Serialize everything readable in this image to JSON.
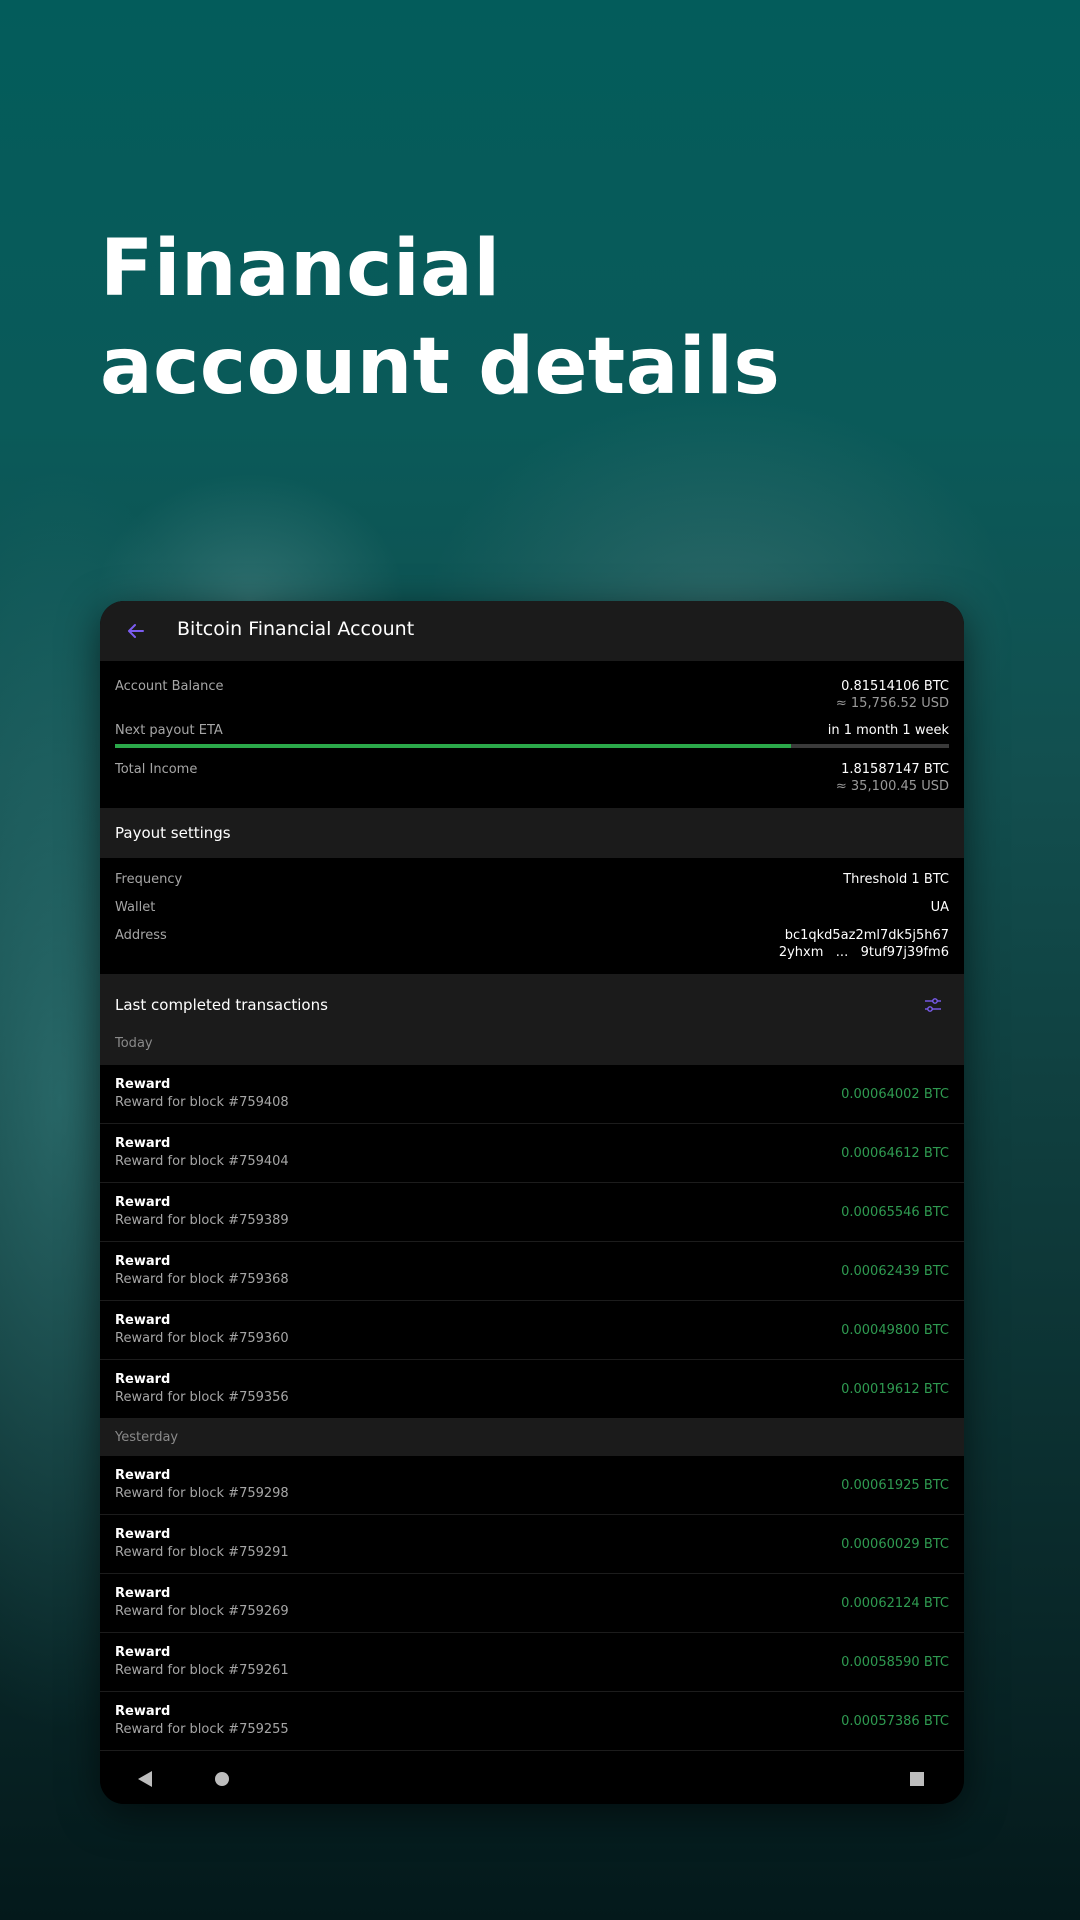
{
  "hero": {
    "title": "Financial account details"
  },
  "app": {
    "title": "Bitcoin Financial Account",
    "accent_color": "#7b5cf0"
  },
  "account": {
    "balance_label": "Account Balance",
    "balance_btc": "0.81514106 BTC",
    "balance_usd": "≈ 15,756.52 USD",
    "payout_label": "Next payout ETA",
    "payout_value": "in 1 month 1 week",
    "payout_progress": 0.81,
    "income_label": "Total Income",
    "income_btc": "1.81587147 BTC",
    "income_usd": "≈ 35,100.45 USD"
  },
  "payout_settings": {
    "title": "Payout settings",
    "frequency_label": "Frequency",
    "frequency_value": "Threshold 1 BTC",
    "wallet_label": "Wallet",
    "wallet_value": "UA",
    "address_label": "Address",
    "address_line1": "bc1qkd5az2ml7dk5j5h67",
    "address_line2": "2yhxm   ...   9tuf97j39fm6"
  },
  "transactions": {
    "title": "Last completed transactions",
    "filter_icon": "filter-sliders-icon",
    "groups": [
      {
        "label": "Today",
        "items": [
          {
            "title": "Reward",
            "desc": "Reward for block #759408",
            "amount": "0.00064002 BTC"
          },
          {
            "title": "Reward",
            "desc": "Reward for block #759404",
            "amount": "0.00064612 BTC"
          },
          {
            "title": "Reward",
            "desc": "Reward for block #759389",
            "amount": "0.00065546 BTC"
          },
          {
            "title": "Reward",
            "desc": "Reward for block #759368",
            "amount": "0.00062439 BTC"
          },
          {
            "title": "Reward",
            "desc": "Reward for block #759360",
            "amount": "0.00049800 BTC"
          },
          {
            "title": "Reward",
            "desc": "Reward for block #759356",
            "amount": "0.00019612 BTC"
          }
        ]
      },
      {
        "label": "Yesterday",
        "items": [
          {
            "title": "Reward",
            "desc": "Reward for block #759298",
            "amount": "0.00061925 BTC"
          },
          {
            "title": "Reward",
            "desc": "Reward for block #759291",
            "amount": "0.00060029 BTC"
          },
          {
            "title": "Reward",
            "desc": "Reward for block #759269",
            "amount": "0.00062124 BTC"
          },
          {
            "title": "Reward",
            "desc": "Reward for block #759261",
            "amount": "0.00058590 BTC"
          },
          {
            "title": "Reward",
            "desc": "Reward for block #759255",
            "amount": "0.00057386 BTC"
          }
        ]
      }
    ]
  },
  "navbar": {
    "back_icon": "nav-back-triangle-icon",
    "home_icon": "nav-home-circle-icon",
    "recents_icon": "nav-recents-square-icon"
  }
}
